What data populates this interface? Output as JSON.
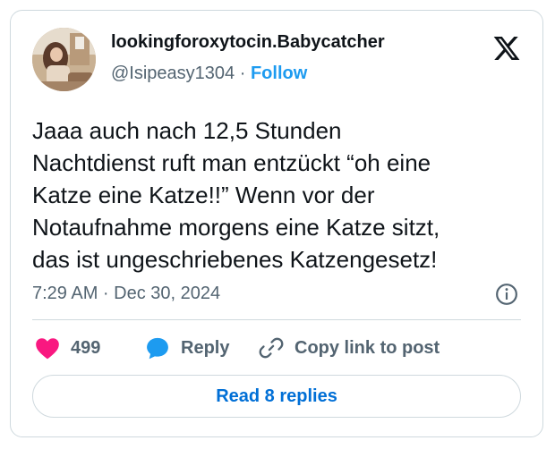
{
  "author": {
    "display_name": "lookingforoxytocin.Babycatcher",
    "handle": "@Isipeasy1304",
    "separator": "·",
    "follow_label": "Follow",
    "avatar_icon": "profile-photo"
  },
  "brand": {
    "logo_icon": "x-logo-icon",
    "accent_color": "#1d9bf0",
    "like_color": "#f91880"
  },
  "tweet": {
    "lines": [
      "Jaaa auch nach 12,5 Stunden",
      "Nachtdienst ruft man entzückt “oh eine",
      "Katze eine Katze!!” Wenn vor der",
      "Notaufnahme morgens eine Katze sitzt,",
      "das ist ungeschriebenes Katzengesetz!"
    ],
    "timestamp": "7:29 AM · Dec 30, 2024"
  },
  "actions": {
    "like_count": "499",
    "reply_label": "Reply",
    "copy_label": "Copy link to post"
  },
  "footer": {
    "read_replies_label": "Read 8 replies"
  }
}
